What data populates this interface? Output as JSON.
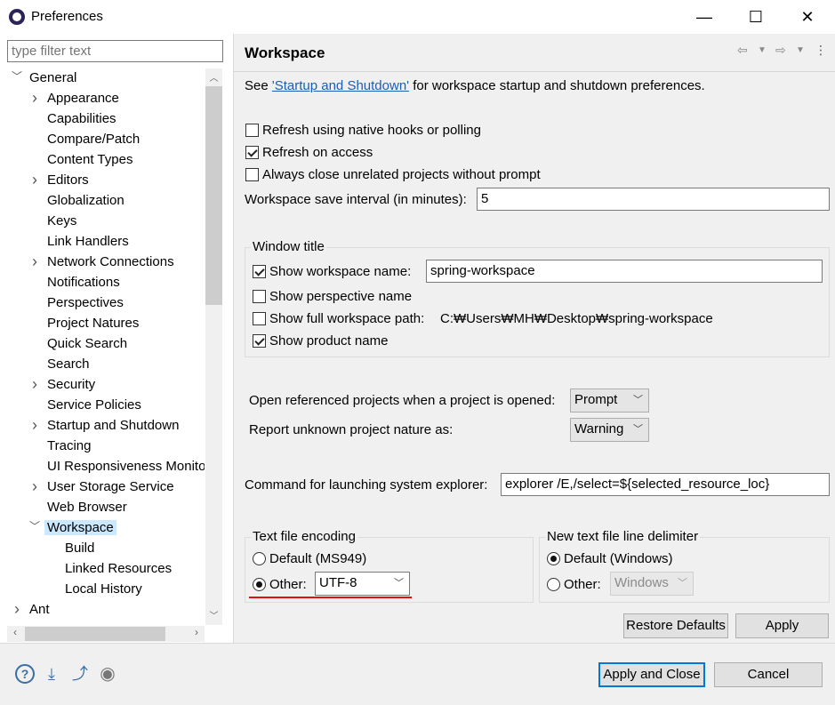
{
  "window": {
    "title": "Preferences",
    "minimize_glyph": "—",
    "maximize_glyph": "☐",
    "close_glyph": "✕"
  },
  "filter": {
    "placeholder": "type filter text"
  },
  "tree": [
    {
      "label": "General",
      "level": 0,
      "arrow": "expanded"
    },
    {
      "label": "Appearance",
      "level": 1,
      "arrow": "collapsed"
    },
    {
      "label": "Capabilities",
      "level": 1,
      "arrow": "none"
    },
    {
      "label": "Compare/Patch",
      "level": 1,
      "arrow": "none"
    },
    {
      "label": "Content Types",
      "level": 1,
      "arrow": "none"
    },
    {
      "label": "Editors",
      "level": 1,
      "arrow": "collapsed"
    },
    {
      "label": "Globalization",
      "level": 1,
      "arrow": "none"
    },
    {
      "label": "Keys",
      "level": 1,
      "arrow": "none"
    },
    {
      "label": "Link Handlers",
      "level": 1,
      "arrow": "none"
    },
    {
      "label": "Network Connections",
      "level": 1,
      "arrow": "collapsed"
    },
    {
      "label": "Notifications",
      "level": 1,
      "arrow": "none"
    },
    {
      "label": "Perspectives",
      "level": 1,
      "arrow": "none"
    },
    {
      "label": "Project Natures",
      "level": 1,
      "arrow": "none"
    },
    {
      "label": "Quick Search",
      "level": 1,
      "arrow": "none"
    },
    {
      "label": "Search",
      "level": 1,
      "arrow": "none"
    },
    {
      "label": "Security",
      "level": 1,
      "arrow": "collapsed"
    },
    {
      "label": "Service Policies",
      "level": 1,
      "arrow": "none"
    },
    {
      "label": "Startup and Shutdown",
      "level": 1,
      "arrow": "collapsed"
    },
    {
      "label": "Tracing",
      "level": 1,
      "arrow": "none"
    },
    {
      "label": "UI Responsiveness Monitoring",
      "level": 1,
      "arrow": "none"
    },
    {
      "label": "User Storage Service",
      "level": 1,
      "arrow": "collapsed"
    },
    {
      "label": "Web Browser",
      "level": 1,
      "arrow": "none"
    },
    {
      "label": "Workspace",
      "level": 1,
      "arrow": "expanded",
      "selected": true
    },
    {
      "label": "Build",
      "level": 2,
      "arrow": "none"
    },
    {
      "label": "Linked Resources",
      "level": 2,
      "arrow": "none"
    },
    {
      "label": "Local History",
      "level": 2,
      "arrow": "none"
    },
    {
      "label": "Ant",
      "level": 0,
      "arrow": "collapsed"
    }
  ],
  "page": {
    "title": "Workspace",
    "intro_prefix": "See ",
    "intro_link": "'Startup and Shutdown'",
    "intro_suffix": " for workspace startup and shutdown preferences.",
    "refresh_native": {
      "label": "Refresh using native hooks or polling",
      "checked": false
    },
    "refresh_access": {
      "label": "Refresh on access",
      "checked": true
    },
    "always_close": {
      "label": "Always close unrelated projects without prompt",
      "checked": false
    },
    "save_interval": {
      "label": "Workspace save interval (in minutes):",
      "value": "5"
    },
    "window_title": {
      "group_label": "Window title",
      "show_workspace_name": {
        "label": "Show workspace name:",
        "checked": true,
        "value": "spring-workspace"
      },
      "show_perspective_name": {
        "label": "Show perspective name",
        "checked": false
      },
      "show_full_path": {
        "label": "Show full workspace path:",
        "checked": false,
        "path": "C:₩Users₩MH₩Desktop₩spring-workspace"
      },
      "show_product_name": {
        "label": "Show product name",
        "checked": true
      }
    },
    "open_referenced": {
      "label": "Open referenced projects when a project is opened:",
      "value": "Prompt"
    },
    "report_unknown": {
      "label": "Report unknown project nature as:",
      "value": "Warning"
    },
    "explorer_command": {
      "label": "Command for launching system explorer:",
      "value": "explorer /E,/select=${selected_resource_loc}"
    },
    "encoding": {
      "group_label": "Text file encoding",
      "default_label": "Default (MS949)",
      "other_label": "Other:",
      "selected": "other",
      "other_value": "UTF-8"
    },
    "line_delimiter": {
      "group_label": "New text file line delimiter",
      "default_label": "Default (Windows)",
      "other_label": "Other:",
      "selected": "default",
      "other_value": "Windows"
    },
    "restore_defaults": "Restore Defaults",
    "apply": "Apply"
  },
  "footer": {
    "apply_and_close": "Apply and Close",
    "cancel": "Cancel"
  },
  "colors": {
    "accent": "#0078d7",
    "selection": "#cce8ff",
    "link": "#1a5fb4",
    "highlight_underline": "#e01010"
  }
}
